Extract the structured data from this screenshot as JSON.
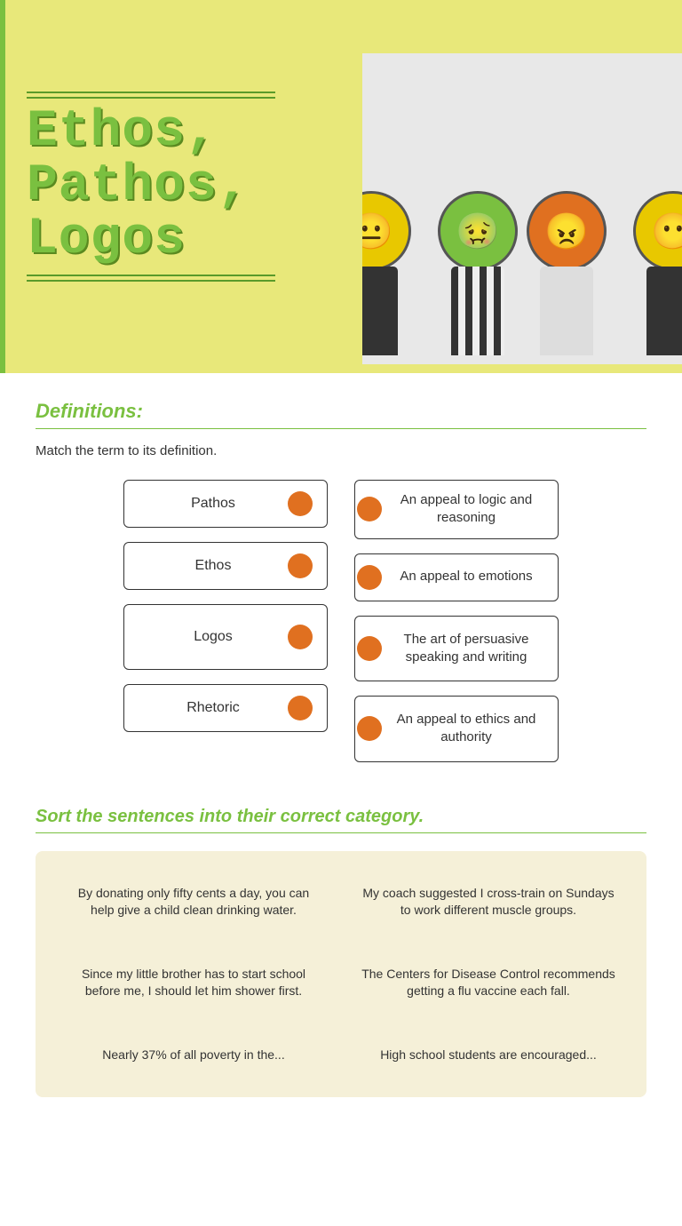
{
  "hero": {
    "title_line1": "Ethos, Pathos,",
    "title_line2": "Logos"
  },
  "definitions_section": {
    "title": "Definitions:",
    "instruction": "Match the term to its definition.",
    "terms": [
      {
        "id": "pathos",
        "label": "Pathos"
      },
      {
        "id": "ethos",
        "label": "Ethos"
      },
      {
        "id": "logos",
        "label": "Logos"
      },
      {
        "id": "rhetoric",
        "label": "Rhetoric"
      }
    ],
    "definitions": [
      {
        "id": "def1",
        "text": "An appeal to logic and reasoning"
      },
      {
        "id": "def2",
        "text": "An appeal to emotions"
      },
      {
        "id": "def3",
        "text": "The art of persuasive speaking and writing"
      },
      {
        "id": "def4",
        "text": "An appeal to ethics and authority"
      }
    ]
  },
  "sort_section": {
    "title": "Sort the sentences into their correct category.",
    "cards": [
      {
        "id": "card1",
        "text": "By donating only fifty cents a day, you can help give a child clean drinking water."
      },
      {
        "id": "card2",
        "text": "My coach suggested I cross-train on Sundays to work different muscle groups."
      },
      {
        "id": "card3",
        "text": "Since my little brother has to start school before me, I should let him shower first."
      },
      {
        "id": "card4",
        "text": "The Centers for Disease Control recommends getting a flu vaccine each fall."
      },
      {
        "id": "card5",
        "text": "Nearly 37% of all poverty in the..."
      },
      {
        "id": "card6",
        "text": "High school students are encouraged..."
      }
    ]
  }
}
